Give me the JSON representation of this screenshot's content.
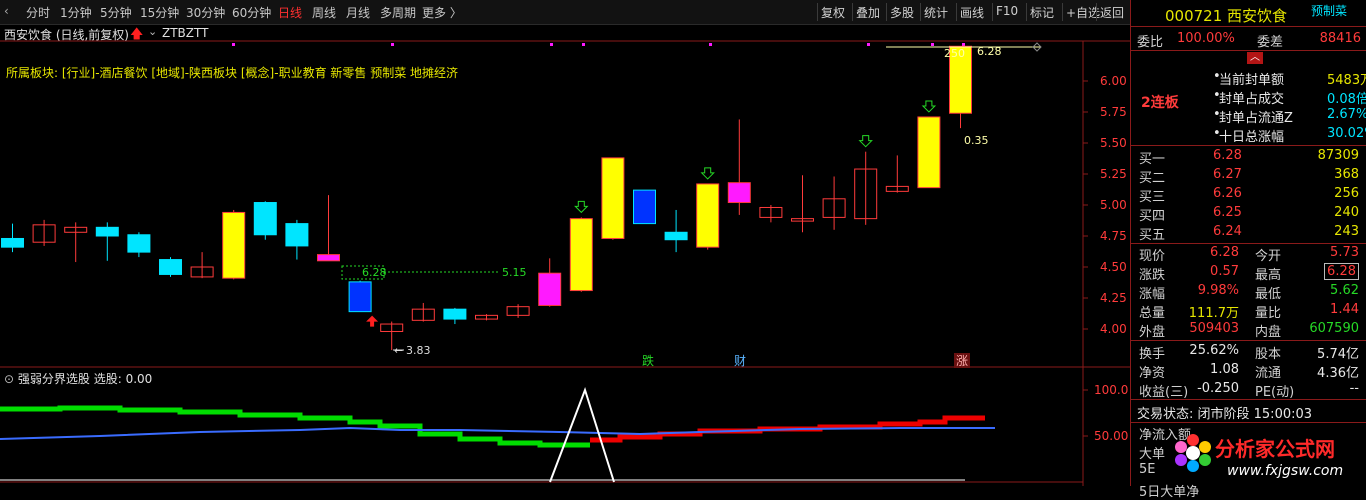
{
  "toolbar": {
    "left": [
      "分时",
      "1分钟",
      "5分钟",
      "15分钟",
      "30分钟",
      "60分钟",
      "日线",
      "周线",
      "月线",
      "多周期",
      "更多 〉"
    ],
    "active": "日线",
    "right": [
      "复权",
      "叠加",
      "多股",
      "统计",
      "画线",
      "F10",
      "标记",
      "+自选",
      "返回"
    ]
  },
  "chart": {
    "title": "西安饮食 (日线,前复权)",
    "indicator": "ZTBZTT",
    "sector": "所属板块: [行业]-酒店餐饮 [地域]-陕西板块 [概念]-职业教育 新零售 预制菜 地摊经济",
    "y_labels": [
      "6.00",
      "5.75",
      "5.50",
      "5.25",
      "5.00",
      "4.75",
      "4.50",
      "4.25",
      "4.00"
    ],
    "low_label": "3.83",
    "line_label_left": "6.28",
    "line_label_right": "5.15",
    "top_label_a": "250",
    "top_label_b": "6.28",
    "label_035": "0.35",
    "events": [
      "跌",
      "财",
      "涨"
    ],
    "indicator_title": "强弱分界选股",
    "indicator_value": "选股: 0.00",
    "ind_y_labels": [
      "100.0",
      "50.00"
    ]
  },
  "chart_data": {
    "type": "candlestick",
    "ylim": [
      3.75,
      6.3
    ],
    "candles": [
      {
        "o": 4.66,
        "h": 4.85,
        "l": 4.62,
        "c": 4.73,
        "color": "cyan"
      },
      {
        "o": 4.7,
        "h": 4.88,
        "l": 4.67,
        "c": 4.84,
        "color": "red_hollow"
      },
      {
        "o": 4.78,
        "h": 4.86,
        "l": 4.54,
        "c": 4.82,
        "color": "red_hollow"
      },
      {
        "o": 4.82,
        "h": 4.86,
        "l": 4.55,
        "c": 4.75,
        "color": "cyan"
      },
      {
        "o": 4.76,
        "h": 4.78,
        "l": 4.58,
        "c": 4.62,
        "color": "cyan"
      },
      {
        "o": 4.56,
        "h": 4.58,
        "l": 4.42,
        "c": 4.44,
        "color": "cyan"
      },
      {
        "o": 4.42,
        "h": 4.62,
        "l": 4.41,
        "c": 4.5,
        "color": "red_hollow"
      },
      {
        "o": 4.41,
        "h": 4.96,
        "l": 4.4,
        "c": 4.94,
        "color": "yellow"
      },
      {
        "o": 5.02,
        "h": 5.03,
        "l": 4.72,
        "c": 4.76,
        "color": "cyan"
      },
      {
        "o": 4.85,
        "h": 4.88,
        "l": 4.56,
        "c": 4.67,
        "color": "cyan"
      },
      {
        "o": 4.6,
        "h": 5.08,
        "l": 4.57,
        "c": 4.55,
        "color": "magenta"
      },
      {
        "o": 4.38,
        "h": 4.39,
        "l": 4.14,
        "c": 4.14,
        "color": "blue"
      },
      {
        "o": 3.98,
        "h": 4.06,
        "l": 3.83,
        "c": 4.04,
        "color": "red_hollow"
      },
      {
        "o": 4.07,
        "h": 4.21,
        "l": 4.06,
        "c": 4.16,
        "color": "red_hollow"
      },
      {
        "o": 4.16,
        "h": 4.17,
        "l": 4.04,
        "c": 4.08,
        "color": "cyan"
      },
      {
        "o": 4.08,
        "h": 4.12,
        "l": 4.07,
        "c": 4.11,
        "color": "red_hollow"
      },
      {
        "o": 4.11,
        "h": 4.2,
        "l": 4.09,
        "c": 4.18,
        "color": "red_hollow"
      },
      {
        "o": 4.19,
        "h": 4.57,
        "l": 4.18,
        "c": 4.45,
        "color": "magenta"
      },
      {
        "o": 4.31,
        "h": 4.9,
        "l": 4.3,
        "c": 4.89,
        "color": "yellow"
      },
      {
        "o": 4.73,
        "h": 5.38,
        "l": 4.72,
        "c": 5.38,
        "color": "yellow"
      },
      {
        "o": 5.12,
        "h": 5.12,
        "l": 4.85,
        "c": 4.85,
        "color": "blue"
      },
      {
        "o": 4.78,
        "h": 4.96,
        "l": 4.62,
        "c": 4.72,
        "color": "cyan"
      },
      {
        "o": 4.66,
        "h": 5.17,
        "l": 4.64,
        "c": 5.17,
        "color": "yellow"
      },
      {
        "o": 5.02,
        "h": 5.69,
        "l": 4.92,
        "c": 5.18,
        "color": "magenta"
      },
      {
        "o": 4.9,
        "h": 5.0,
        "l": 4.86,
        "c": 4.98,
        "color": "red_hollow"
      },
      {
        "o": 4.87,
        "h": 5.24,
        "l": 4.78,
        "c": 4.89,
        "color": "red_hollow"
      },
      {
        "o": 4.9,
        "h": 5.23,
        "l": 4.8,
        "c": 5.05,
        "color": "red_hollow"
      },
      {
        "o": 4.89,
        "h": 5.43,
        "l": 4.84,
        "c": 5.29,
        "color": "red_hollow"
      },
      {
        "o": 5.11,
        "h": 5.4,
        "l": 5.1,
        "c": 5.15,
        "color": "red_hollow"
      },
      {
        "o": 5.14,
        "h": 5.71,
        "l": 5.14,
        "c": 5.71,
        "color": "yellow"
      },
      {
        "o": 5.74,
        "h": 6.28,
        "l": 5.62,
        "c": 6.28,
        "color": "yellow"
      }
    ],
    "down_arrow_candles": [
      18,
      22,
      27,
      29
    ],
    "up_arrow_candle": 11
  },
  "side": {
    "code_name": "000721 西安饮食",
    "tag": "预制菜",
    "weibi_label": "委比",
    "weibi": "100.00%",
    "weicha_label": "委差",
    "weicha": "88416",
    "lianban": "2连板",
    "seal_rows": [
      {
        "label": "当前封单额",
        "value": "5483万"
      },
      {
        "label": "封单占成交",
        "value": "0.08倍"
      },
      {
        "label": "封单占流通Z",
        "value": "2.67%"
      },
      {
        "label": "十日总涨幅",
        "value": "30.02%"
      }
    ],
    "buy": [
      {
        "label": "买一",
        "price": "6.28",
        "vol": "87309"
      },
      {
        "label": "买二",
        "price": "6.27",
        "vol": "368"
      },
      {
        "label": "买三",
        "price": "6.26",
        "vol": "256"
      },
      {
        "label": "买四",
        "price": "6.25",
        "vol": "240"
      },
      {
        "label": "买五",
        "price": "6.24",
        "vol": "243"
      }
    ],
    "quote": [
      {
        "l1": "现价",
        "v1": "6.28",
        "l2": "今开",
        "v2": "5.73"
      },
      {
        "l1": "涨跌",
        "v1": "0.57",
        "l2": "最高",
        "v2": "6.28"
      },
      {
        "l1": "涨幅",
        "v1": "9.98%",
        "l2": "最低",
        "v2": "5.62"
      },
      {
        "l1": "总量",
        "v1": "111.7万",
        "l2": "量比",
        "v2": "1.44"
      },
      {
        "l1": "外盘",
        "v1": "509403",
        "l2": "内盘",
        "v2": "607590"
      }
    ],
    "fin": [
      {
        "l1": "换手",
        "v1": "25.62%",
        "l2": "股本",
        "v2": "5.74亿"
      },
      {
        "l1": "净资",
        "v1": "1.08",
        "l2": "流通",
        "v2": "4.36亿"
      },
      {
        "l1": "收益(三)",
        "v1": "-0.250",
        "l2": "PE(动)",
        "v2": "--"
      }
    ],
    "trade_status": "交易状态: 闭市阶段 15:00:03",
    "partial": [
      "净流入额",
      "大单",
      "5E",
      "5日大单净"
    ],
    "watermark": "分析家公式网",
    "watermark_url": "www.fxjgsw.com"
  },
  "colors": {
    "up": "#ff3b3b",
    "down_cyan": "#00e5ff",
    "yellow": "#ffff00",
    "magenta": "#ff1aff",
    "blue": "#0033ff",
    "green": "#26d926"
  }
}
